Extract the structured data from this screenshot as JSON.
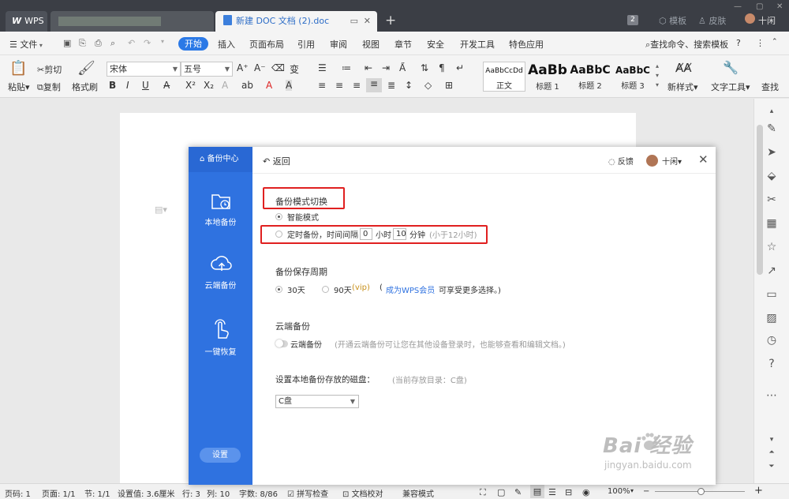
{
  "titlebar": {
    "wps_tab": "WPS",
    "doc_tab": "新建 DOC 文档 (2).doc",
    "close": "✕",
    "new_tab": "+",
    "badge": "2",
    "template": "模板",
    "skin": "皮肤",
    "user": "十闲"
  },
  "menu": {
    "file": "文件",
    "items": [
      "开始",
      "插入",
      "页面布局",
      "引用",
      "审阅",
      "视图",
      "章节",
      "安全",
      "开发工具",
      "特色应用"
    ],
    "search": "查找命令、搜索模板",
    "help": "?"
  },
  "toolbar": {
    "paste": "粘贴",
    "cut": "剪切",
    "copy": "复制",
    "format_painter": "格式刷",
    "font_name": "宋体",
    "font_size": "五号",
    "styles": [
      {
        "preview": "AaBbCcDd",
        "label": "正文"
      },
      {
        "preview": "AaBb",
        "label": "标题 1"
      },
      {
        "preview": "AaBbC",
        "label": "标题 2"
      },
      {
        "preview": "AaBbC",
        "label": "标题 3"
      }
    ],
    "new_style": "新样式",
    "text_tools": "文字工具",
    "find": "查找"
  },
  "status": {
    "page_no": "页码: 1",
    "pages": "页面: 1/1",
    "section": "节: 1/1",
    "setting": "设置值: 3.6厘米",
    "row": "行: 3",
    "col": "列: 10",
    "words": "字数: 8/86",
    "spell": "拼写检查",
    "proof": "文档校对",
    "compat": "兼容模式",
    "zoom": "100%"
  },
  "dialog": {
    "sidebar_title": "备份中心",
    "nav": [
      "本地备份",
      "云端备份",
      "一键恢复"
    ],
    "settings": "设置",
    "back": "返回",
    "feedback": "反馈",
    "user": "十闲",
    "mode_title": "备份模式切换",
    "smart_mode": "智能模式",
    "timed_label": "定时备份，时间间隔",
    "hours_value": "0",
    "hours_unit": "小时",
    "minutes_value": "10",
    "minutes_unit": "分钟",
    "timed_hint": "(小于12小时)",
    "period_title": "备份保存周期",
    "period_30": "30天",
    "period_90": "90天",
    "vip_tag": "(vip)",
    "vip_open": "(",
    "vip_link": "成为WPS会员",
    "vip_rest": "可享受更多选择。)",
    "cloud_title": "云端备份",
    "cloud_toggle": "云端备份",
    "cloud_hint": "(开通云端备份可让您在其他设备登录时，也能够查看和编辑文档。)",
    "disk_title": "设置本地备份存放的磁盘：",
    "disk_current": "(当前存放目录：C盘)",
    "disk_value": "C盘"
  },
  "watermark": {
    "brand": "Bai 经验",
    "url": "jingyan.baidu.com"
  }
}
